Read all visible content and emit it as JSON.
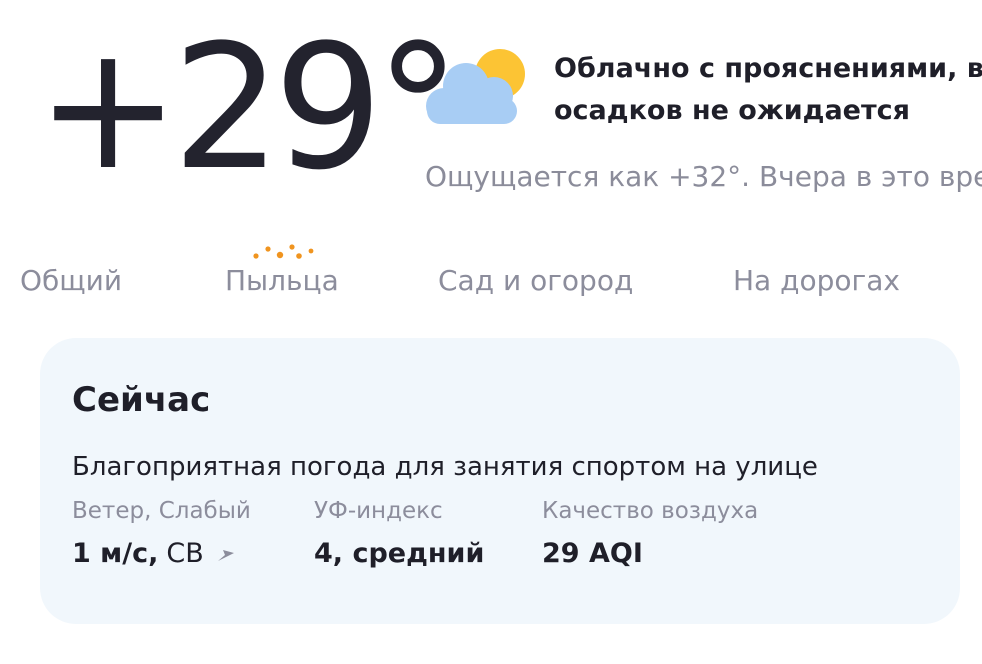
{
  "current": {
    "temperature": "+29°",
    "icon": "partly-cloudy-icon",
    "condition_line1": "Облачно с прояснениями, в б",
    "condition_line2": "осадков не ожидается",
    "feels_like": "Ощущается как +32°. Вчера в это вре"
  },
  "tabs": [
    {
      "label": "Общий"
    },
    {
      "label": "Пыльца",
      "indicator": "pollen-dots-icon"
    },
    {
      "label": "Сад и огород"
    },
    {
      "label": "На дорогах"
    }
  ],
  "card": {
    "title": "Сейчас",
    "description": "Благоприятная погода для занятия спортом на улице",
    "wind": {
      "label": "Ветер, Слабый",
      "value": "1 м/с,",
      "direction": "СВ",
      "arrow_icon": "wind-direction-arrow-icon"
    },
    "uv": {
      "label": "УФ-индекс",
      "value": "4, средний"
    },
    "air": {
      "label": "Качество воздуха",
      "value": "29 AQI"
    }
  },
  "colors": {
    "text_primary": "#1f1f29",
    "text_secondary": "#8c8d9c",
    "card_bg": "#f1f7fc",
    "cloud": "#a8cdf4",
    "sun": "#fcc434",
    "pollen": "#f0941f"
  }
}
